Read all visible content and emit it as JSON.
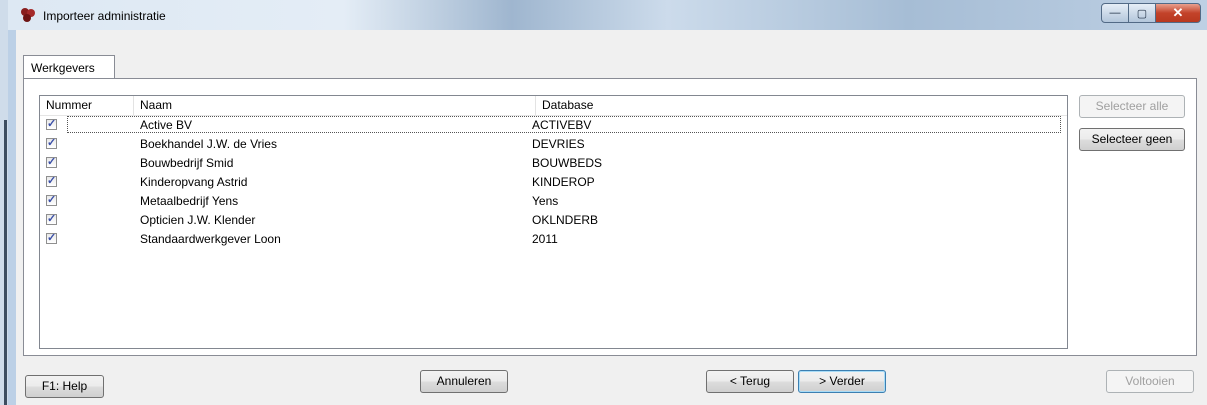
{
  "window": {
    "title": "Importeer administratie",
    "min_glyph": "—",
    "max_glyph": "▢",
    "close_glyph": "✕"
  },
  "tab": {
    "label": "Werkgevers"
  },
  "list": {
    "columns": [
      "Nummer",
      "Naam",
      "Database"
    ],
    "rows": [
      {
        "checked": true,
        "nummer": "",
        "naam": "Active BV",
        "database": "ACTIVEBV"
      },
      {
        "checked": true,
        "nummer": "",
        "naam": "Boekhandel J.W. de Vries",
        "database": "DEVRIES"
      },
      {
        "checked": true,
        "nummer": "",
        "naam": "Bouwbedrijf Smid",
        "database": "BOUWBEDS"
      },
      {
        "checked": true,
        "nummer": "",
        "naam": "Kinderopvang Astrid",
        "database": "KINDEROP"
      },
      {
        "checked": true,
        "nummer": "",
        "naam": "Metaalbedrijf Yens",
        "database": "Yens"
      },
      {
        "checked": true,
        "nummer": "",
        "naam": "Opticien J.W. Klender",
        "database": "OKLNDERB"
      },
      {
        "checked": true,
        "nummer": "",
        "naam": "Standaardwerkgever Loon",
        "database": "2011"
      }
    ]
  },
  "buttons": {
    "select_all": "Selecteer alle",
    "select_none": "Selecteer geen",
    "help": "F1: Help",
    "cancel": "Annuleren",
    "back": "< Terug",
    "next": "> Verder",
    "finish": "Voltooien"
  }
}
